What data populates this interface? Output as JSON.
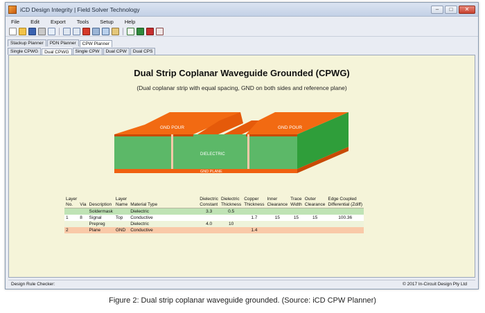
{
  "window": {
    "title": "iCD Design Integrity | Field Solver Technology",
    "minimize": "–",
    "maximize": "□",
    "close": "✕"
  },
  "menu": [
    "File",
    "Edit",
    "Export",
    "Tools",
    "Setup",
    "Help"
  ],
  "toolbar_icons": [
    "new-icon",
    "open-icon",
    "save-icon",
    "print-icon",
    "preview-icon",
    "undo-icon",
    "redo-icon",
    "delete-icon",
    "cut-icon",
    "copy-icon",
    "paste-icon",
    "chart-icon",
    "excel-icon",
    "pdf-icon",
    "settings-icon"
  ],
  "top_tabs": [
    "Stackup Planner",
    "PDN Planner",
    "CPW Planner"
  ],
  "sub_tabs": [
    "Single CPWG",
    "Dual CPWG",
    "Single CPW",
    "Dual CPW",
    "Dual CPS"
  ],
  "heading": "Dual Strip Coplanar Waveguide Grounded (CPWG)",
  "subheading": "(Dual coplanar strip with equal spacing, GND on both sides and reference plane)",
  "diagram": {
    "gnd_pour_left": "GND POUR",
    "gnd_pour_right": "GND POUR",
    "dielectric": "DIELECTRIC",
    "gnd_plane": "GND PLANE",
    "colors": {
      "copper": "#f26a12",
      "copper_dark": "#c84a05",
      "dielectric": "#5cb868",
      "dielectric_side": "#2f9e3a",
      "plane": "#f06010"
    }
  },
  "table": {
    "headers": [
      [
        "Layer",
        "No."
      ],
      [
        "Via"
      ],
      [
        "Description"
      ],
      [
        "Layer",
        "Name"
      ],
      [
        "Material Type"
      ],
      [
        "Dielectric",
        "Constant"
      ],
      [
        "Dielectric",
        "Thickness"
      ],
      [
        "Copper",
        "Thickness"
      ],
      [
        "Inner",
        "Clearance"
      ],
      [
        "Trace",
        "Width"
      ],
      [
        "Outer",
        "Clearance"
      ],
      [
        "Edge Coupled",
        "Differential (Zdiff)"
      ]
    ],
    "rows": [
      {
        "cls": "r-solder",
        "cells": [
          "",
          "",
          "Soldermask",
          "",
          "Dielectric",
          "3.3",
          "0.5",
          "",
          "",
          "",
          "",
          ""
        ]
      },
      {
        "cls": "r-signal",
        "cells": [
          "1",
          "8",
          "Signal",
          "Top",
          "Conductive",
          "",
          "",
          "1.7",
          "15",
          "15",
          "15",
          "100.36"
        ]
      },
      {
        "cls": "r-prepreg",
        "cells": [
          "",
          "",
          "Prepreg",
          "",
          "Dielectric",
          "4.0",
          "10",
          "",
          "",
          "",
          "",
          ""
        ]
      },
      {
        "cls": "r-plane",
        "cells": [
          "2",
          "",
          "Plane",
          "GND",
          "Conductive",
          "",
          "",
          "1.4",
          "",
          "",
          "",
          ""
        ]
      }
    ]
  },
  "status": {
    "left": "Design Rule Checker:",
    "right": "© 2017 In-Circuit Design Pty Ltd"
  },
  "caption": "Figure 2: Dual strip coplanar waveguide grounded. (Source: iCD CPW Planner)"
}
